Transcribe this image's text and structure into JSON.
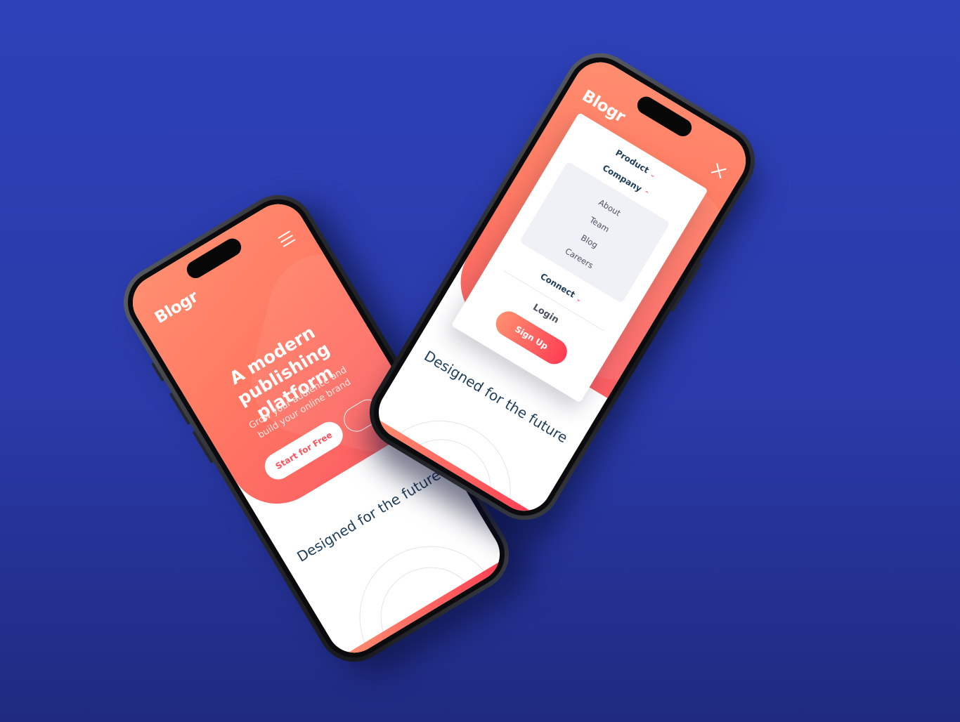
{
  "brand": {
    "accent": "#ff525d",
    "gradient_start": "#ff8f70",
    "gradient_end": "#ff3d54",
    "navy": "#1f3e5a",
    "background": "#2d41b8"
  },
  "left_phone": {
    "logo": "Blogr",
    "menu_icon": "hamburger-icon",
    "hero": {
      "title": "A modern publishing platform",
      "subtitle": "Grow your audience and build your online brand",
      "primary_cta": "Start for Free"
    },
    "section_title": "Designed for the future"
  },
  "right_phone": {
    "logo": "Blogr",
    "close_icon": "close-icon",
    "menu": {
      "items": [
        {
          "label": "Product",
          "chevron": "⌄"
        },
        {
          "label": "Company",
          "chevron": "⌃"
        }
      ],
      "company_submenu": [
        "About",
        "Team",
        "Blog",
        "Careers"
      ],
      "connect": {
        "label": "Connect",
        "chevron": "⌄"
      },
      "login": "Login",
      "signup": "Sign Up"
    },
    "section_title": "Designed for the future"
  }
}
